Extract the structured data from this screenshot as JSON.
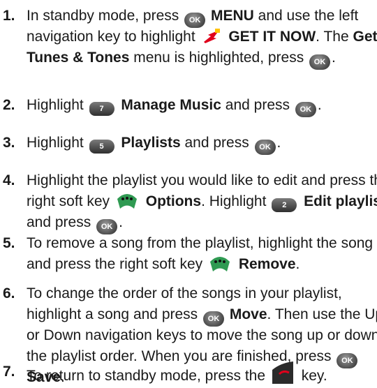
{
  "steps": [
    {
      "num": "1.",
      "lines": [
        [
          {
            "t": "In standby mode, press "
          },
          {
            "i": "ok",
            "name": "ok-key-icon"
          },
          {
            "t": " "
          },
          {
            "b": "MENU"
          },
          {
            "t": " and use the left"
          }
        ],
        [
          {
            "t": "navigation key to highlight "
          },
          {
            "i": "getitnow",
            "name": "get-it-now-icon"
          },
          {
            "t": " "
          },
          {
            "b": "GET IT NOW"
          },
          {
            "t": ". The "
          },
          {
            "b": "Get"
          }
        ],
        [
          {
            "b": "Tunes & Tones"
          },
          {
            "t": " menu is highlighted, press "
          },
          {
            "i": "ok",
            "name": "ok-key-icon"
          },
          {
            "t": "."
          }
        ]
      ]
    },
    {
      "num": "2.",
      "lines": [
        [
          {
            "t": "Highlight "
          },
          {
            "i": "key7",
            "name": "key-7-icon"
          },
          {
            "t": " "
          },
          {
            "b": "Manage Music"
          },
          {
            "t": " and press "
          },
          {
            "i": "ok",
            "name": "ok-key-icon"
          },
          {
            "t": "."
          }
        ]
      ]
    },
    {
      "num": "3.",
      "lines": [
        [
          {
            "t": "Highlight "
          },
          {
            "i": "key5",
            "name": "key-5-icon"
          },
          {
            "t": " "
          },
          {
            "b": "Playlists"
          },
          {
            "t": " and press "
          },
          {
            "i": "ok",
            "name": "ok-key-icon"
          },
          {
            "t": "."
          }
        ]
      ]
    },
    {
      "num": "4.",
      "lines": [
        [
          {
            "t": "Highlight the playlist you would like to edit and press the"
          }
        ],
        [
          {
            "t": "right soft key "
          },
          {
            "i": "soft",
            "name": "right-soft-key-icon"
          },
          {
            "t": " "
          },
          {
            "b": "Options"
          },
          {
            "t": ". Highlight "
          },
          {
            "i": "key2",
            "name": "key-2-icon"
          },
          {
            "t": " "
          },
          {
            "b": "Edit playlist"
          }
        ],
        [
          {
            "t": "and press "
          },
          {
            "i": "ok",
            "name": "ok-key-icon"
          },
          {
            "t": "."
          }
        ]
      ]
    },
    {
      "num": "5.",
      "lines": [
        [
          {
            "t": "To remove a song from the playlist, highlight the song"
          }
        ],
        [
          {
            "t": "and press the right soft key "
          },
          {
            "i": "soft",
            "name": "right-soft-key-icon"
          },
          {
            "t": " "
          },
          {
            "b": "Remove"
          },
          {
            "t": "."
          }
        ]
      ]
    },
    {
      "num": "6.",
      "lines": [
        [
          {
            "t": "To change the order of the songs in your playlist,"
          }
        ],
        [
          {
            "t": "highlight a song and press "
          },
          {
            "i": "ok",
            "name": "ok-key-icon"
          },
          {
            "t": " "
          },
          {
            "b": "Move"
          },
          {
            "t": ". Then use the Up"
          }
        ],
        [
          {
            "t": "or Down navigation keys to move the song up or down in"
          }
        ],
        [
          {
            "t": "the playlist order. When you are finished, press "
          },
          {
            "i": "ok",
            "name": "ok-key-icon"
          }
        ],
        [
          {
            "b": "Save"
          },
          {
            "t": "."
          }
        ]
      ]
    },
    {
      "num": "7.",
      "lines": [
        [
          {
            "t": "To return to standby mode, press the "
          },
          {
            "i": "end",
            "name": "end-key-icon"
          },
          {
            "t": " key."
          }
        ]
      ]
    }
  ],
  "icons": {
    "ok": {
      "text": "OK"
    },
    "key7": {
      "text": "7"
    },
    "key5": {
      "text": "5"
    },
    "key2": {
      "text": "2"
    }
  }
}
